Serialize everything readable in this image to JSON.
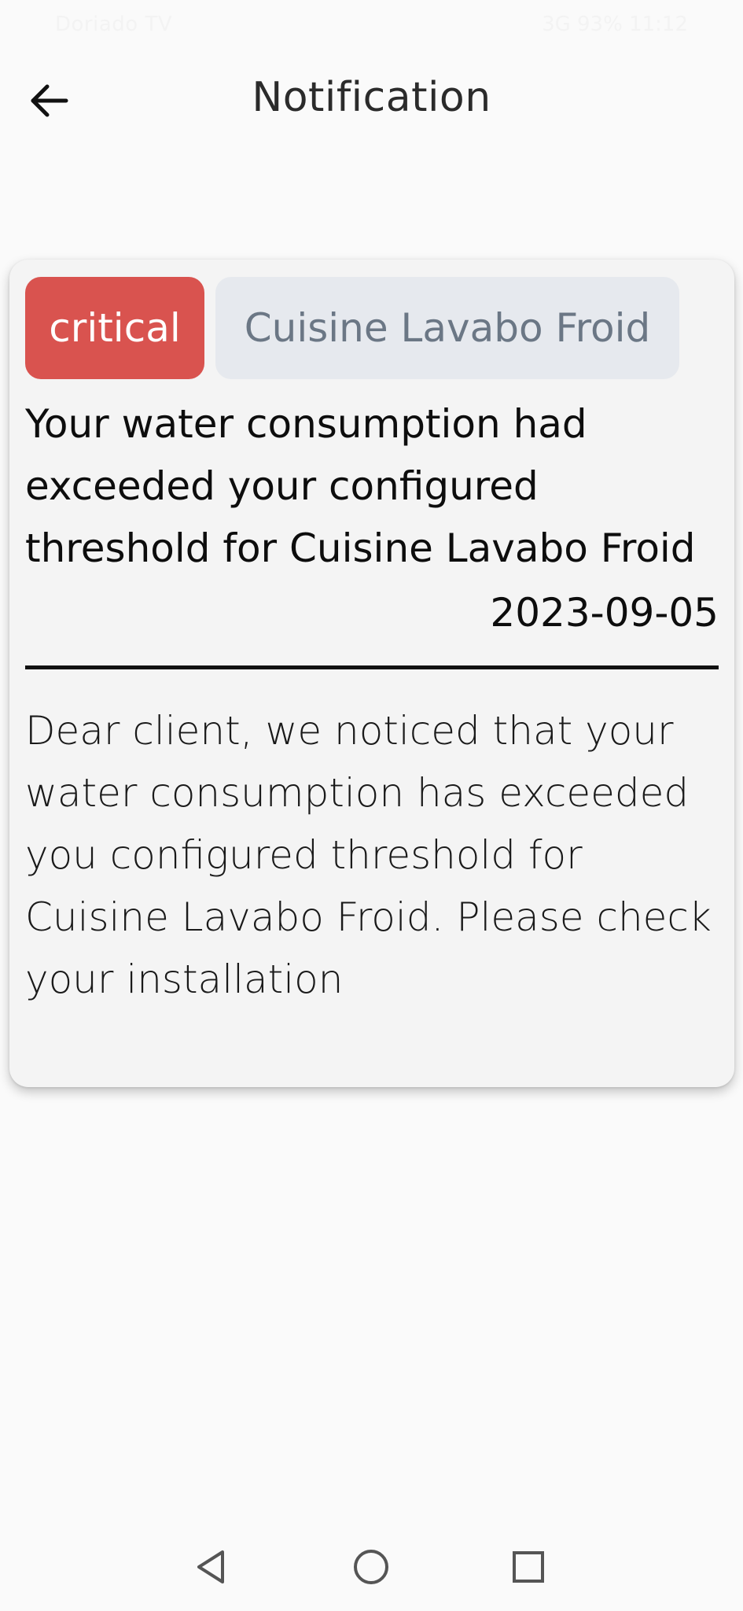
{
  "status_bar": {
    "left_text": "Doriado TV",
    "right_text": "3G 93% 11:12"
  },
  "app_bar": {
    "title": "Notification",
    "back_icon": "arrow-left-icon"
  },
  "notification": {
    "severity": "critical",
    "location": "Cuisine Lavabo Froid",
    "title": "Your water consumption had exceeded your configured threshold for Cuisine Lavabo Froid",
    "date": "2023-09-05",
    "body": "Dear client, we noticed that your water consumption has exceeded you configured threshold for Cuisine Lavabo Froid. Please check your installation"
  },
  "colors": {
    "critical_bg": "#d9534f",
    "location_bg": "#e6e9ee",
    "location_text": "#6b7785",
    "page_bg": "#fafafa",
    "card_bg": "#f4f4f4"
  },
  "nav_bar": {
    "back_icon": "triangle-back-icon",
    "home_icon": "circle-home-icon",
    "recents_icon": "square-recents-icon"
  }
}
